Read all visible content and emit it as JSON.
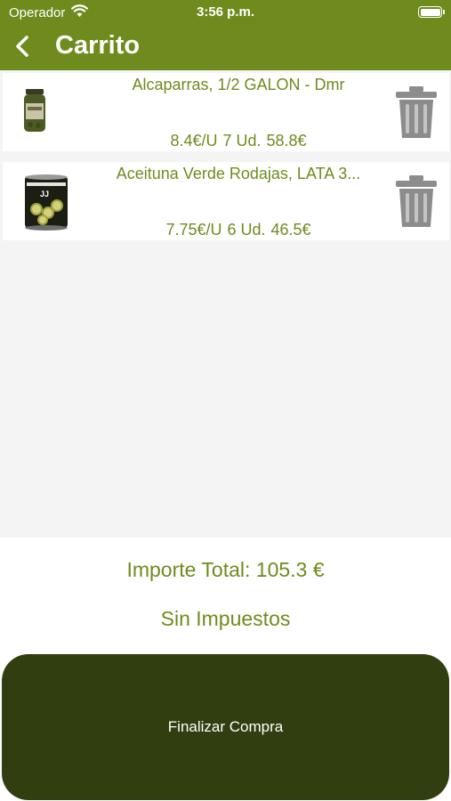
{
  "status_bar": {
    "carrier": "Operador",
    "time": "3:56 p.m."
  },
  "nav": {
    "title": "Carrito",
    "back_icon": "chevron-left-icon"
  },
  "items": [
    {
      "name": "Alcaparras, 1/2 GALON - Dmr",
      "unit_price": "8.4€/U",
      "quantity": "7 Ud.",
      "subtotal": "58.8€",
      "image": "olive-jar-image"
    },
    {
      "name": "Aceituna Verde Rodajas, LATA 3...",
      "unit_price": "7.75€/U",
      "quantity": "6 Ud.",
      "subtotal": "46.5€",
      "image": "olive-can-image"
    }
  ],
  "summary": {
    "total": "Importe Total: 105.3 €",
    "tax_note": "Sin Impuestos",
    "checkout_label": "Finalizar Compra"
  },
  "colors": {
    "brand": "#6f8b1d",
    "button": "#313f10",
    "text_accent": "#6f8b1d"
  }
}
